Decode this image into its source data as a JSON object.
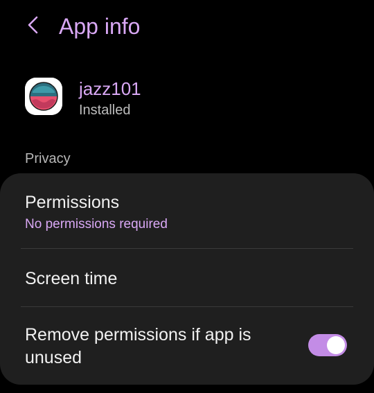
{
  "header": {
    "title": "App info",
    "back_icon": "chevron-left-icon"
  },
  "app": {
    "name": "jazz101",
    "status": "Installed"
  },
  "privacy": {
    "section_label": "Privacy",
    "permissions": {
      "title": "Permissions",
      "subtitle": "No permissions required"
    },
    "screen_time": {
      "title": "Screen time"
    },
    "remove_unused": {
      "title_line1": "Remove permissions if app is",
      "title_line2": "unused",
      "enabled": true
    }
  },
  "colors": {
    "accent": "#d9a8f5",
    "toggle_on": "#c38ce6",
    "background": "#000000",
    "card": "#1f1f1f"
  }
}
